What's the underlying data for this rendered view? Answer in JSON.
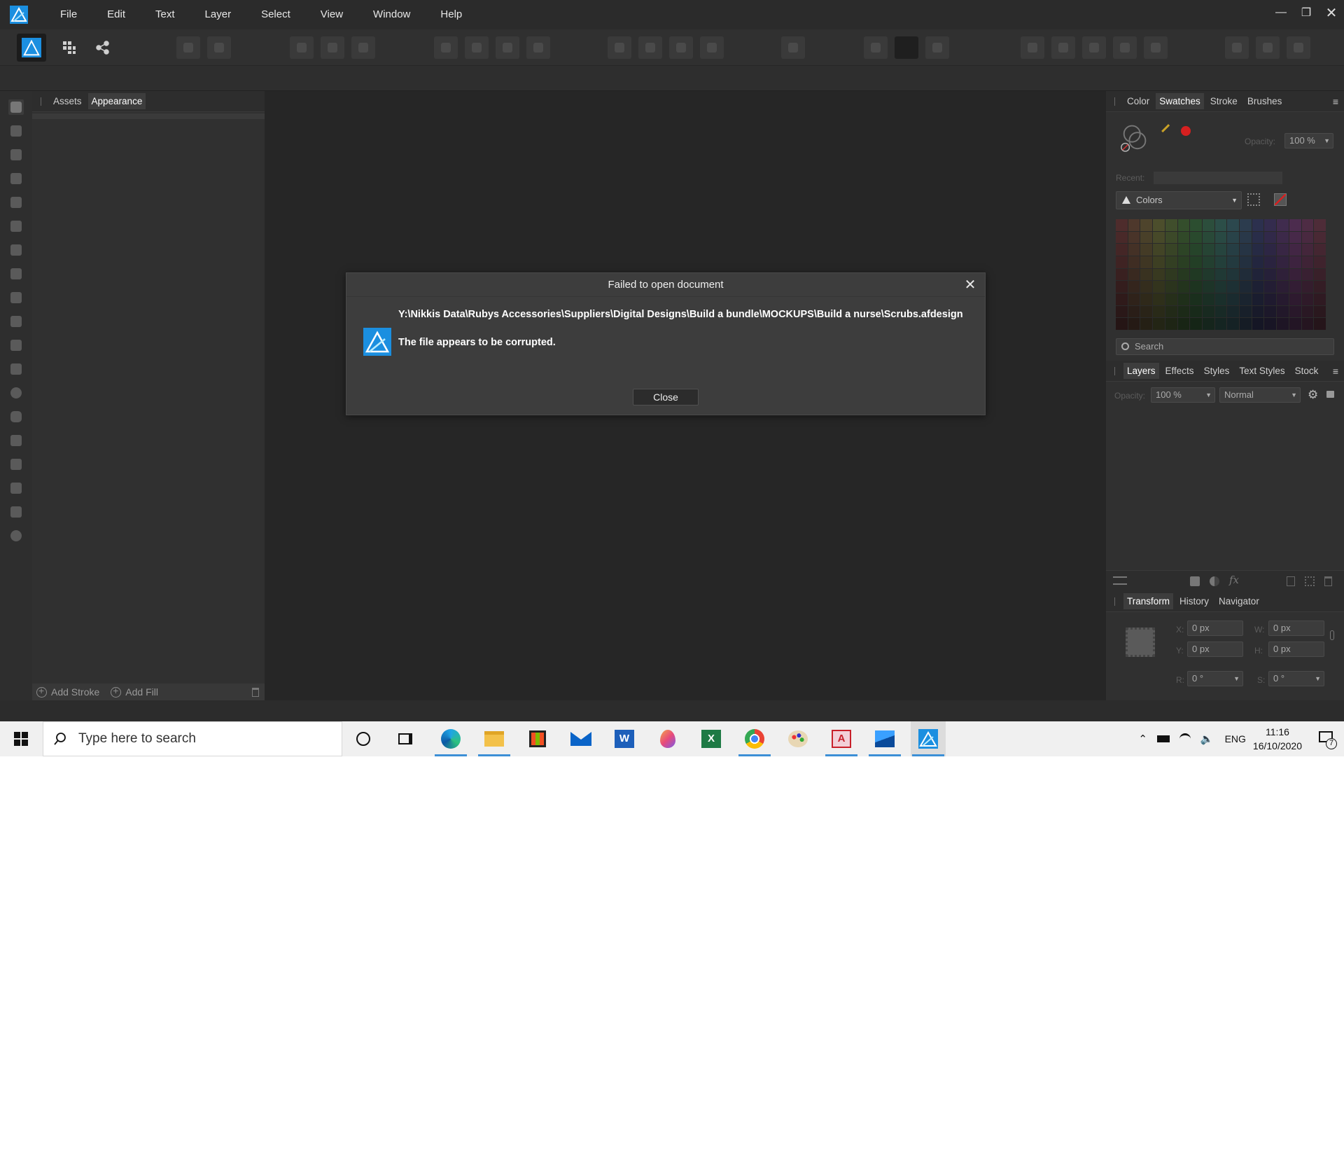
{
  "menubar": {
    "items": [
      "File",
      "Edit",
      "Text",
      "Layer",
      "Select",
      "View",
      "Window",
      "Help"
    ]
  },
  "left_panel": {
    "tabs": [
      "Assets",
      "Appearance"
    ],
    "active_tab": "Appearance",
    "footer": {
      "add_stroke": "Add Stroke",
      "add_fill": "Add Fill"
    }
  },
  "right_panel": {
    "color_tabs": [
      "Color",
      "Swatches",
      "Stroke",
      "Brushes"
    ],
    "active_color_tab": "Swatches",
    "opacity_label": "Opacity:",
    "opacity_value": "100 %",
    "recent_label": "Recent:",
    "palette_select": "Colors",
    "search_placeholder": "Search",
    "layers_tabs": [
      "Layers",
      "Effects",
      "Styles",
      "Text Styles",
      "Stock"
    ],
    "active_layers_tab": "Layers",
    "layers_opacity_label": "Opacity:",
    "layers_opacity_value": "100 %",
    "blend_mode": "Normal",
    "transform_tabs": [
      "Transform",
      "History",
      "Navigator"
    ],
    "active_transform_tab": "Transform",
    "transform": {
      "x_label": "X:",
      "x": "0 px",
      "y_label": "Y:",
      "y": "0 px",
      "w_label": "W:",
      "w": "0 px",
      "h_label": "H:",
      "h": "0 px",
      "r_label": "R:",
      "r": "0 °",
      "s_label": "S:",
      "s": "0 °"
    }
  },
  "dialog": {
    "title": "Failed to open document",
    "path": "Y:\\Nikkis Data\\Rubys Accessories\\Suppliers\\Digital Designs\\Build a bundle\\MOCKUPS\\Build a nurse\\Scrubs.afdesign",
    "message": "The file appears to be corrupted.",
    "close_button": "Close"
  },
  "taskbar": {
    "search_placeholder": "Type here to search",
    "language": "ENG",
    "time": "11:16",
    "date": "16/10/2020",
    "notification_count": "7",
    "apps": [
      "cortana-icon",
      "task-view-icon",
      "edge-icon",
      "file-explorer-icon",
      "store-icon",
      "mail-icon",
      "word-icon",
      "paint3d-icon",
      "excel-icon",
      "chrome-icon",
      "paint-icon",
      "access-icon",
      "photos-icon",
      "affinity-designer-icon"
    ]
  },
  "colors": {
    "accent": "#3c8fd6",
    "brand": "#1b9ef0",
    "record_red": "#d62020"
  }
}
